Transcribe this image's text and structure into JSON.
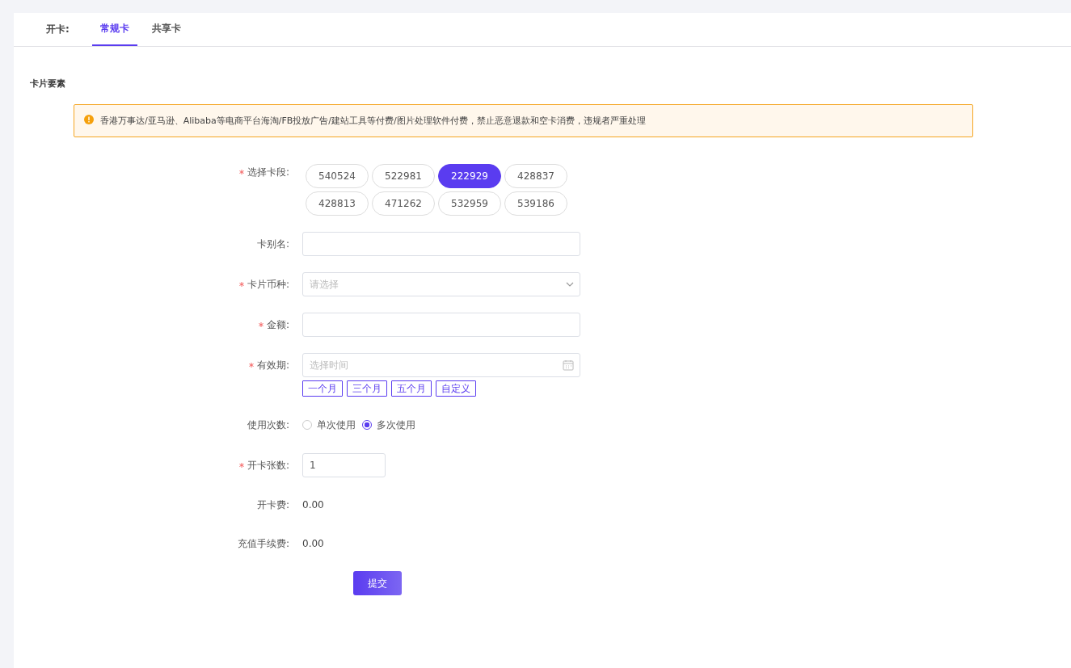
{
  "tabs": {
    "label": "开卡:",
    "items": [
      {
        "label": "常规卡",
        "selected": true
      },
      {
        "label": "共享卡",
        "selected": false
      }
    ]
  },
  "section_title": "卡片要素",
  "alert": {
    "kind": "warning",
    "text": "香港万事达/亚马逊、Alibaba等电商平台海淘/FB投放广告/建站工具等付费/图片处理软件付费，禁止恶意退款和空卡消费，违规者严重处理"
  },
  "form": [
    {
      "kind": "chips",
      "label": "选择卡段:",
      "required": true,
      "options": [
        {
          "label": "540524",
          "selected": false
        },
        {
          "label": "522981",
          "selected": false
        },
        {
          "label": "222929",
          "selected": true
        },
        {
          "label": "428837",
          "selected": false
        },
        {
          "label": "428813",
          "selected": false
        },
        {
          "label": "471262",
          "selected": false
        },
        {
          "label": "532959",
          "selected": false
        },
        {
          "label": "539186",
          "selected": false
        }
      ]
    },
    {
      "kind": "text",
      "label": "卡别名:",
      "required": false
    },
    {
      "kind": "select",
      "label": "卡片币种:",
      "required": true,
      "placeholder": "请选择"
    },
    {
      "kind": "text",
      "label": "金额:",
      "required": true
    },
    {
      "kind": "date",
      "label": "有效期:",
      "required": true,
      "placeholder": "选择时间",
      "shortcuts": [
        "一个月",
        "三个月",
        "五个月",
        "自定义"
      ]
    },
    {
      "kind": "radio",
      "label": "使用次数:",
      "required": false,
      "options": [
        {
          "label": "单次使用",
          "selected": false
        },
        {
          "label": "多次使用",
          "selected": true
        }
      ]
    },
    {
      "kind": "number",
      "label": "开卡张数:",
      "required": true,
      "value": "1"
    },
    {
      "kind": "value",
      "label": "开卡费:",
      "required": false,
      "value": "0.00"
    },
    {
      "kind": "value",
      "label": "充值手续费:",
      "required": false,
      "value": "0.00"
    }
  ],
  "submit": "提交"
}
